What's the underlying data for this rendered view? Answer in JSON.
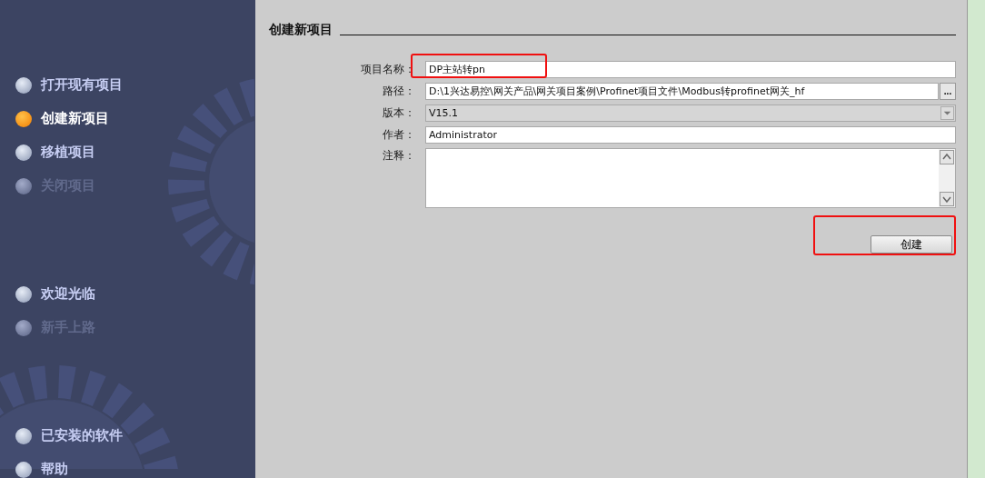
{
  "sidebar": {
    "groups": [
      {
        "items": [
          {
            "label": "打开现有项目",
            "selected": false,
            "disabled": false
          },
          {
            "label": "创建新项目",
            "selected": true,
            "disabled": false
          },
          {
            "label": "移植项目",
            "selected": false,
            "disabled": false
          },
          {
            "label": "关闭项目",
            "selected": false,
            "disabled": true
          }
        ]
      },
      {
        "items": [
          {
            "label": "欢迎光临",
            "selected": false,
            "disabled": false
          },
          {
            "label": "新手上路",
            "selected": false,
            "disabled": true
          }
        ]
      },
      {
        "items": [
          {
            "label": "已安装的软件",
            "selected": false,
            "disabled": false
          },
          {
            "label": "帮助",
            "selected": false,
            "disabled": false
          }
        ]
      }
    ]
  },
  "panel": {
    "title": "创建新项目",
    "fields": [
      {
        "kind": "text",
        "label": "项目名称：",
        "value": "DP主站转pn",
        "annotated": true
      },
      {
        "kind": "browse",
        "label": "路径：",
        "value": "D:\\1兴达易控\\网关产品\\网关项目案例\\Profinet项目文件\\Modbus转profinet网关_hf",
        "button": "...",
        "annotated": false
      },
      {
        "kind": "select",
        "label": "版本：",
        "value": "V15.1",
        "annotated": false
      },
      {
        "kind": "text",
        "label": "作者：",
        "value": "Administrator",
        "annotated": false
      },
      {
        "kind": "textarea",
        "label": "注释：",
        "annotated": false
      }
    ],
    "create_button": {
      "label": "创建",
      "annotated": true
    }
  }
}
